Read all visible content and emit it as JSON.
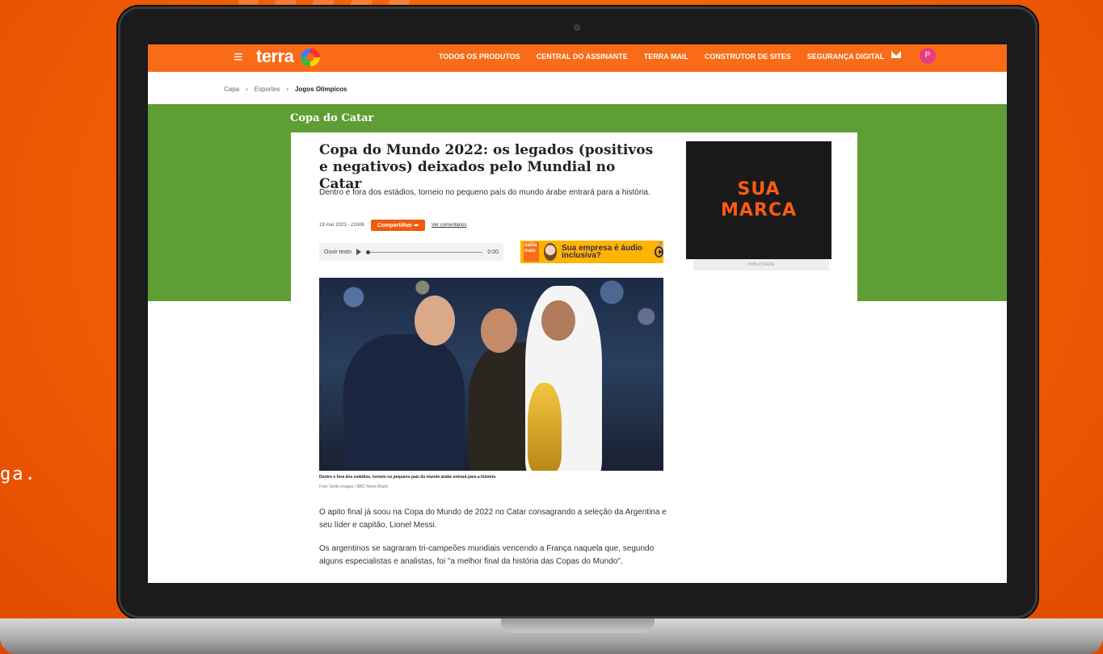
{
  "background": {
    "side_text": "ga.",
    "accent": "#f25c05"
  },
  "nav": {
    "brand": "terra",
    "links": [
      "TODOS OS PRODUTOS",
      "CENTRAL DO ASSINANTE",
      "TERRA MAIL",
      "CONSTRUTOR DE SITES",
      "SEGURANÇA DIGITAL"
    ],
    "avatar_initial": "P",
    "color": "#f96b16"
  },
  "breadcrumb": {
    "items": [
      "Capa",
      "Esportes",
      "Jogos Olímpicos"
    ]
  },
  "section": {
    "title": "Copa do Catar",
    "color": "#5e9e35"
  },
  "article": {
    "title": "Copa do Mundo 2022: os legados (positivos e negativos) deixados pelo Mundial no Catar",
    "subtitle": "Dentro e fora dos estádios, torneio no pequeno país do mundo árabe entrará para a história.",
    "date": "19 mar 2023 - 21h06",
    "share_label": "Compartilhar",
    "comments_label": "Ver comentários",
    "audio": {
      "label": "Ouvir texto",
      "time": "0:00"
    },
    "audio_ad": {
      "badge": "saiba mais",
      "text": "Sua empresa é áudio inclusiva?"
    },
    "photo_caption": "Dentro e fora dos estádios, torneio no pequeno país do mundo árabe entrará para a história",
    "photo_credit": "Foto: Getty Images / BBC News Brasil",
    "paragraphs": [
      "O apito final já soou na Copa do Mundo de 2022 no Catar consagrando a seleção da Argentina e seu líder e capitão, Lionel Messi.",
      "Os argentinos se sagraram tri-campeões mundiais vencendo a França naquela que, segundo alguns especialistas e analistas, foi \"a melhor final da história das Copas do Mundo\"."
    ]
  },
  "sidebar_ad": {
    "text": "SUA\nMARCA",
    "label": "PUBLICIDADE"
  }
}
